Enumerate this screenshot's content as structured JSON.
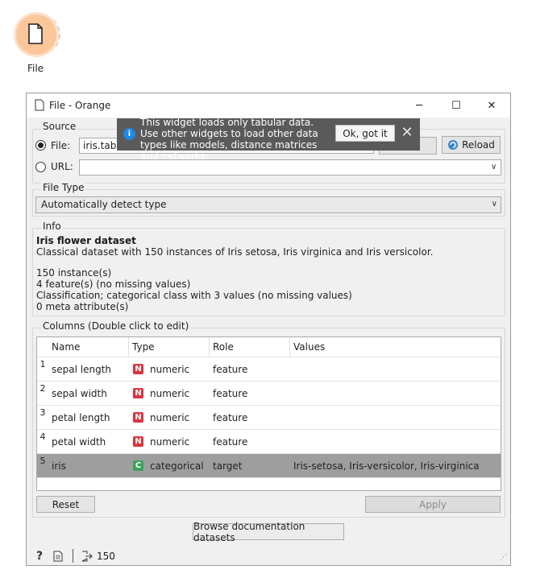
{
  "canvas": {
    "node_label": "File",
    "node_icon": "document-icon"
  },
  "window": {
    "title": "File - Orange",
    "minimize": "─",
    "maximize": "☐",
    "close": "✕"
  },
  "source": {
    "group_label": "Source",
    "file_label": "File:",
    "file_value": "iris.tab",
    "file_selected": true,
    "url_label": "URL:",
    "url_value": "",
    "reload_label": "Reload"
  },
  "tooltip": {
    "text": "This widget loads only tabular data. Use other widgets to load other data types like models, distance matrices and networks.",
    "ok_label": "Ok, got it",
    "close_label": "✕"
  },
  "file_type": {
    "group_label": "File Type",
    "selected": "Automatically detect type"
  },
  "info": {
    "group_label": "Info",
    "title": "Iris flower dataset",
    "description": "Classical dataset with 150 instances of Iris setosa, Iris virginica and Iris versicolor.",
    "instances": "150 instance(s)",
    "features": "4 feature(s) (no missing values)",
    "classification": "Classification; categorical class with 3 values (no missing values)",
    "meta": "0 meta attribute(s)"
  },
  "columns": {
    "group_label": "Columns (Double click to edit)",
    "headers": [
      "Name",
      "Type",
      "Role",
      "Values"
    ],
    "rows": [
      {
        "num": "1",
        "name": "sepal length",
        "type_badge": "N",
        "type": "numeric",
        "role": "feature",
        "values": ""
      },
      {
        "num": "2",
        "name": "sepal width",
        "type_badge": "N",
        "type": "numeric",
        "role": "feature",
        "values": ""
      },
      {
        "num": "3",
        "name": "petal length",
        "type_badge": "N",
        "type": "numeric",
        "role": "feature",
        "values": ""
      },
      {
        "num": "4",
        "name": "petal width",
        "type_badge": "N",
        "type": "numeric",
        "role": "feature",
        "values": ""
      },
      {
        "num": "5",
        "name": "iris",
        "type_badge": "C",
        "type": "categorical",
        "role": "target",
        "values": "Iris-setosa, Iris-versicolor, Iris-virginica"
      }
    ],
    "badge_colors": {
      "numeric": "#d9363e",
      "categorical": "#3aa35c"
    },
    "selected_row_color": "#9e9e9e"
  },
  "buttons": {
    "reset": "Reset",
    "apply": "Apply",
    "browse": "Browse documentation datasets"
  },
  "status": {
    "help_icon": "?",
    "output_count": "150"
  }
}
